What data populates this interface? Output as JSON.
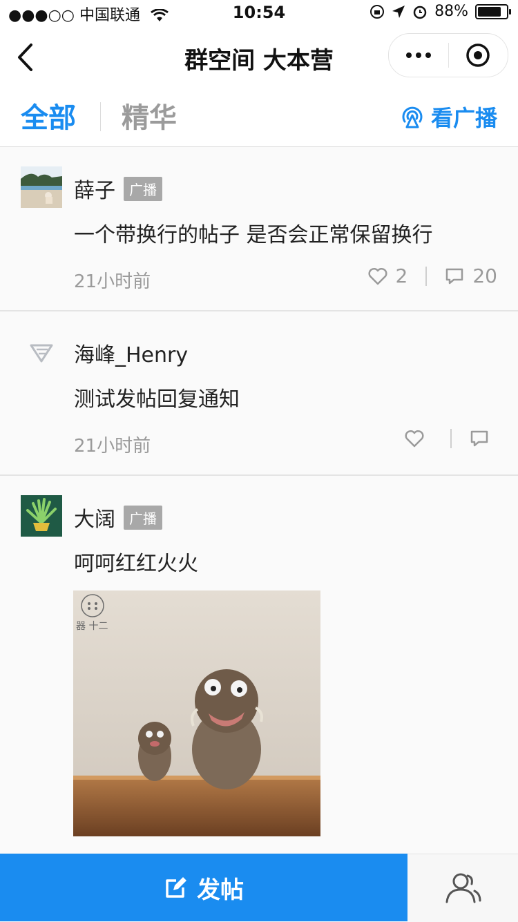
{
  "status_bar": {
    "carrier": "●●●○○ 中国联通",
    "time": "10:54",
    "battery_text": "88%",
    "battery_level": 0.88
  },
  "nav": {
    "title": "群空间 大本营",
    "back_icon": "chevron-left-icon",
    "more_icon": "more-dots-icon",
    "close_icon": "target-icon"
  },
  "tabs": {
    "all": "全部",
    "essence": "精华",
    "broadcast": "看广播"
  },
  "posts": [
    {
      "author": "薛子",
      "badge": "广播",
      "text": "一个带换行的帖子 是否会正常保留换行",
      "time": "21小时前",
      "likes": "2",
      "comments": "20"
    },
    {
      "author": "海峰_Henry",
      "badge": "",
      "text": "测试发帖回复通知",
      "time": "21小时前",
      "likes": "",
      "comments": ""
    },
    {
      "author": "大阔",
      "badge": "广播",
      "text": "呵呵红红火火",
      "image_watermark": "器 十二"
    }
  ],
  "bottom": {
    "post_label": "发帖",
    "members_icon": "members-icon"
  },
  "colors": {
    "accent": "#1a8cf0",
    "badge": "#a8a8a8",
    "muted": "#9a9a9a"
  }
}
